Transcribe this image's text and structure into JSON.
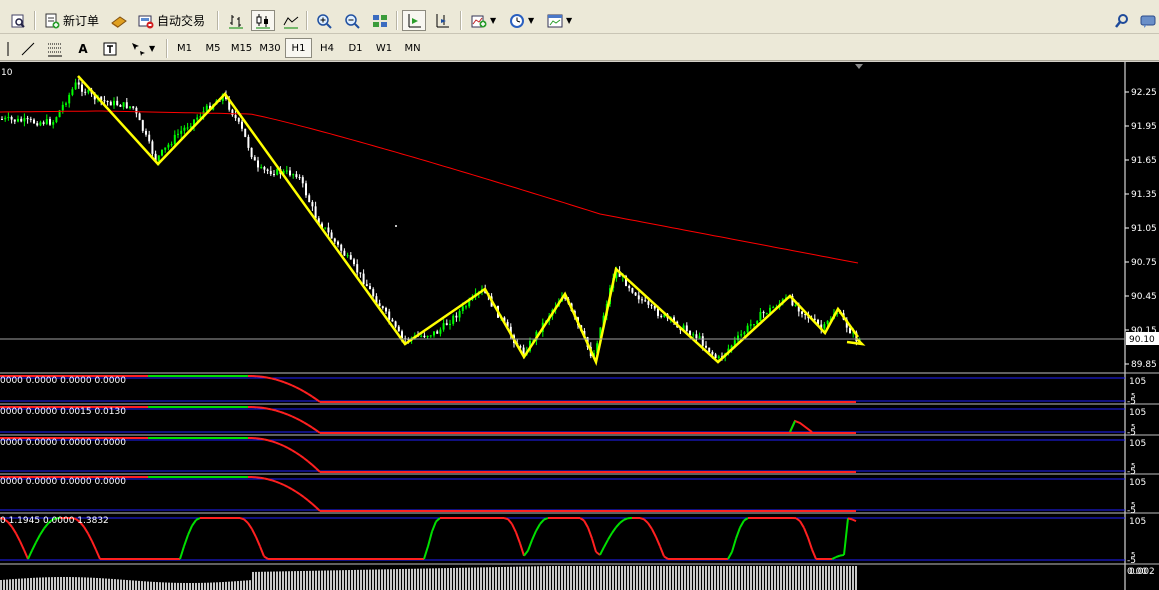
{
  "toolbar": {
    "new_order_label": "新订单",
    "auto_trade_label": "自动交易"
  },
  "timeframes": [
    "M1",
    "M5",
    "M15",
    "M30",
    "H1",
    "H4",
    "D1",
    "W1",
    "MN"
  ],
  "active_timeframe": "H1",
  "chart": {
    "corner_label": "10",
    "price_levels": [
      "92.25",
      "91.95",
      "91.65",
      "91.35",
      "91.05",
      "90.75",
      "90.45",
      "90.15",
      "89.85"
    ],
    "current_price": "90.10",
    "colors": {
      "background": "#000000",
      "bull": "#00ff00",
      "bear": "#ffffff",
      "ma": "#ff0000",
      "overlay": "#ffff00",
      "indicator_frame": "#0000ff"
    }
  },
  "indicators": [
    {
      "values": "0000 0.0000 0.0000 0.0000",
      "scale_top": "105",
      "scale_bottom": "5",
      "scale_extra": "-5"
    },
    {
      "values": "0000 0.0000 0.0015 0.0130",
      "scale_top": "105",
      "scale_bottom": "5",
      "scale_extra": "-5"
    },
    {
      "values": "0000 0.0000 0.0000 0.0000",
      "scale_top": "105",
      "scale_bottom": "5",
      "scale_extra": "-5"
    },
    {
      "values": "0000 0.0000 0.0000 0.0000",
      "scale_top": "105",
      "scale_bottom": "5",
      "scale_extra": "-5"
    },
    {
      "values": "0 1.1945 0.0000 1.3832",
      "scale_top": "105",
      "scale_bottom": "5",
      "scale_extra": "-5"
    }
  ],
  "histogram_scale": "0.002",
  "histogram_scale_bottom": "0.00"
}
